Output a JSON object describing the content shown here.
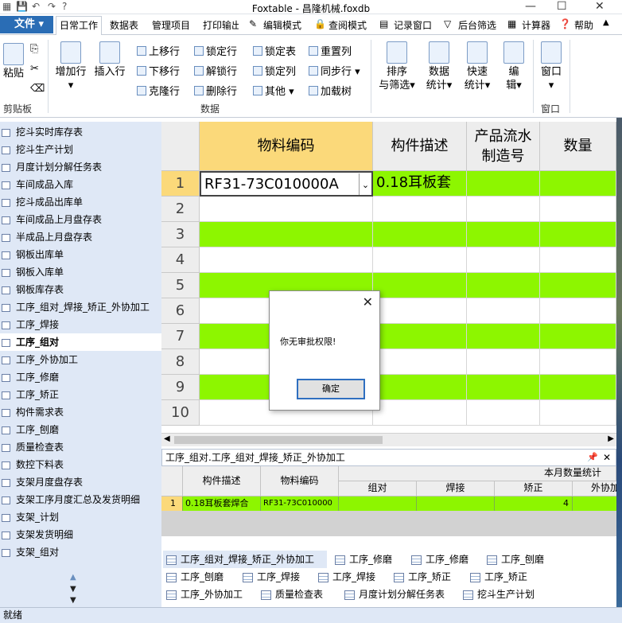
{
  "window": {
    "title": "Foxtable - 昌隆机械.foxdb"
  },
  "ribbon_tabs": [
    "文件",
    "日常工作",
    "数据表",
    "管理项目",
    "打印输出",
    "编辑模式",
    "查阅模式",
    "记录窗口",
    "后台筛选",
    "计算器",
    "帮助"
  ],
  "ribbon": {
    "paste": "粘贴",
    "clipboard_group": "剪贴板",
    "add_row": "增加行",
    "insert_row": "插入行",
    "move_up": "上移行",
    "move_down": "下移行",
    "clone_row": "克隆行",
    "lock_row": "锁定行",
    "unlock_row": "解锁行",
    "delete_row": "删除行",
    "lock_table": "锁定表",
    "lock_column": "锁定列",
    "other": "其他",
    "reset_column": "重置列",
    "sync_row": "同步行",
    "load_tree": "加载树",
    "data_group": "数据",
    "sort_filter": [
      "排序",
      "与筛选"
    ],
    "data_stats": [
      "数据",
      "统计"
    ],
    "quick_stats": [
      "快速",
      "统计"
    ],
    "edit": [
      "编",
      "辑"
    ],
    "window_btn": "窗口",
    "window_group": "窗口"
  },
  "sidebar": {
    "items": [
      "挖斗实时库存表",
      "挖斗生产计划",
      "月度计划分解任务表",
      "车间成品入库",
      "挖斗成品出库单",
      "车间成品上月盘存表",
      "半成品上月盘存表",
      "钢板出库单",
      "钢板入库单",
      "钢板库存表",
      "工序_组对_焊接_矫正_外协加工",
      "工序_焊接",
      "工序_组对",
      "工序_外协加工",
      "工序_修磨",
      "工序_矫正",
      "构件需求表",
      "工序_刨磨",
      "质量检查表",
      "数控下料表",
      "支架月度盘存表",
      "支架工序月度汇总及发货明细",
      "支架_计划",
      "支架发货明细",
      "支架_组对"
    ],
    "selected_index": 12
  },
  "grid": {
    "headers": [
      "物料编码",
      "构件描述",
      "产品流水制造号",
      "数量"
    ],
    "rows": [
      {
        "no": "1",
        "material": "RF31-73C010000A",
        "desc": "0.18耳板套"
      },
      {
        "no": "2",
        "material": "",
        "desc": ""
      },
      {
        "no": "3",
        "material": "",
        "desc": ""
      },
      {
        "no": "4",
        "material": "",
        "desc": ""
      },
      {
        "no": "5",
        "material": "",
        "desc": ""
      },
      {
        "no": "6",
        "material": "",
        "desc": ""
      },
      {
        "no": "7",
        "material": "",
        "desc": ""
      },
      {
        "no": "8",
        "material": "",
        "desc": ""
      },
      {
        "no": "9",
        "material": "",
        "desc": ""
      },
      {
        "no": "10",
        "material": "",
        "desc": ""
      }
    ]
  },
  "subpanel": {
    "title": "工序_组对.工序_组对_焊接_矫正_外协加工",
    "headers": [
      "构件描述",
      "物料编码"
    ],
    "group_header": "本月数量统计",
    "sub_headers": [
      "组对",
      "焊接",
      "矫正",
      "外协加"
    ],
    "row": {
      "no": "1",
      "desc": "0.18耳板套焊合",
      "material": "RF31-73C010000",
      "jiaozheng": "4"
    }
  },
  "bottom_tabs": [
    [
      "工序_组对_焊接_矫正_外协加工",
      "工序_修磨",
      "工序_修磨",
      "工序_刨磨"
    ],
    [
      "工序_刨磨",
      "工序_焊接",
      "工序_焊接",
      "工序_矫正",
      "工序_矫正"
    ],
    [
      "工序_外协加工",
      "质量检查表",
      "月度计划分解任务表",
      "挖斗生产计划"
    ]
  ],
  "dialog": {
    "message": "你无审批权限!",
    "ok": "确定"
  },
  "status": {
    "text": "就绪"
  }
}
